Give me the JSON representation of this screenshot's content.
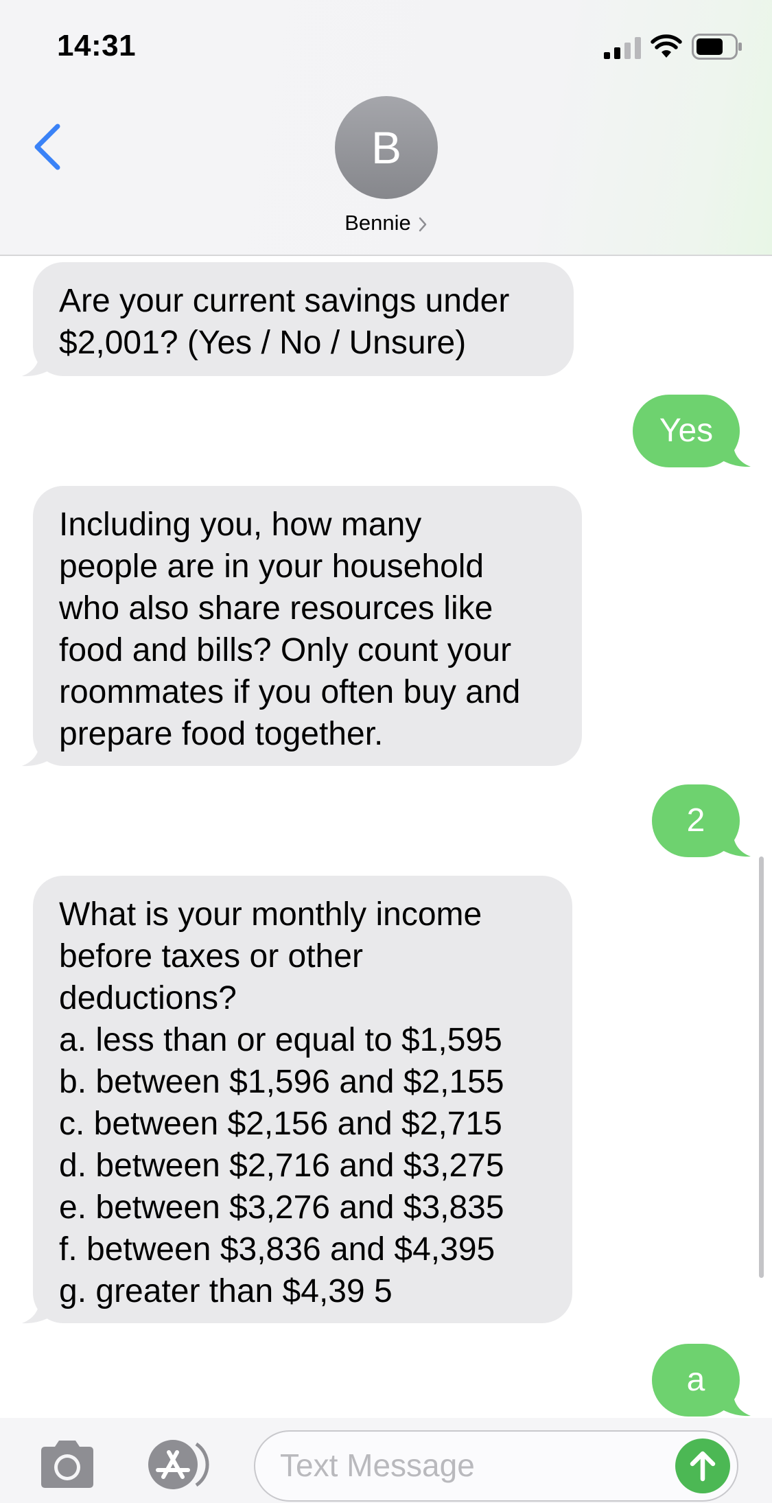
{
  "status_bar": {
    "time": "14:31",
    "signal_icon": "cellular-signal-icon",
    "wifi_icon": "wifi-icon",
    "battery_icon": "battery-icon",
    "battery_level": 0.7
  },
  "header": {
    "back_icon": "chevron-left-icon",
    "avatar_initial": "B",
    "contact_name": "Bennie",
    "contact_chevron": "chevron-right-icon"
  },
  "messages": [
    {
      "direction": "incoming",
      "text": "Are your current savings under\n$2,001? (Yes / No / Unsure)"
    },
    {
      "direction": "outgoing",
      "text": "Yes"
    },
    {
      "direction": "incoming",
      "text": "Including you, how many\npeople are in your household\nwho also share resources like\nfood and bills?  Only count your\nroommates if you often buy and\nprepare food together."
    },
    {
      "direction": "outgoing",
      "text": "2"
    },
    {
      "direction": "incoming",
      "text": "What is your monthly income\nbefore taxes or other\ndeductions?\na. less than or equal to $1,595\nb. between $1,596 and $2,155\nc. between $2,156 and $2,715\nd. between $2,716 and $3,275\ne. between $3,276 and $3,835\nf. between $3,836 and $4,395\ng. greater than $4,39 5"
    },
    {
      "direction": "outgoing",
      "text": "a"
    }
  ],
  "input_bar": {
    "camera_icon": "camera-icon",
    "apps_icon": "app-store-icon",
    "placeholder": "Text Message",
    "send_icon": "arrow-up-icon"
  },
  "colors": {
    "incoming_bubble": "#e9e9eb",
    "outgoing_bubble": "#6ed26f",
    "accent_blue": "#3a82f7",
    "send_button": "#4cb854"
  }
}
